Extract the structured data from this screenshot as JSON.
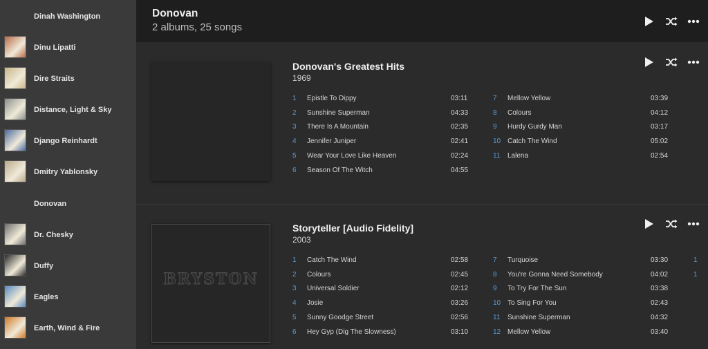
{
  "sidebar": {
    "artists": [
      {
        "name": "Dinah Washington",
        "has_thumb": false,
        "thumb_color": "#3a3a3a"
      },
      {
        "name": "Dinu Lipatti",
        "has_thumb": true,
        "thumb_color": "#b86a4a"
      },
      {
        "name": "Dire Straits",
        "has_thumb": true,
        "thumb_color": "#c9b58a"
      },
      {
        "name": "Distance, Light & Sky",
        "has_thumb": true,
        "thumb_color": "#8a8f8c"
      },
      {
        "name": "Django Reinhardt",
        "has_thumb": true,
        "thumb_color": "#4a6aa0"
      },
      {
        "name": "Dmitry Yablonsky",
        "has_thumb": true,
        "thumb_color": "#b8a98a"
      },
      {
        "name": "Donovan",
        "has_thumb": false,
        "thumb_color": "#3a3a3a"
      },
      {
        "name": "Dr. Chesky",
        "has_thumb": true,
        "thumb_color": "#6e6e6e"
      },
      {
        "name": "Duffy",
        "has_thumb": true,
        "thumb_color": "#2a2a2a"
      },
      {
        "name": "Eagles",
        "has_thumb": true,
        "thumb_color": "#5a8ac0"
      },
      {
        "name": "Earth, Wind & Fire",
        "has_thumb": true,
        "thumb_color": "#d07a2a"
      }
    ]
  },
  "header": {
    "title": "Donovan",
    "subtitle": "2 albums, 25 songs"
  },
  "albums": [
    {
      "title": "Donovan's Greatest Hits",
      "year": "1969",
      "cover_text": "",
      "tracks_left": [
        {
          "num": "1",
          "title": "Epistle To Dippy",
          "duration": "03:11"
        },
        {
          "num": "2",
          "title": "Sunshine Superman",
          "duration": "04:33"
        },
        {
          "num": "3",
          "title": "There Is A Mountain",
          "duration": "02:35"
        },
        {
          "num": "4",
          "title": "Jennifer Juniper",
          "duration": "02:41"
        },
        {
          "num": "5",
          "title": "Wear Your Love Like Heaven",
          "duration": "02:24"
        },
        {
          "num": "6",
          "title": "Season Of The Witch",
          "duration": "04:55"
        }
      ],
      "tracks_right": [
        {
          "num": "7",
          "title": "Mellow Yellow",
          "duration": "03:39"
        },
        {
          "num": "8",
          "title": "Colours",
          "duration": "04:12"
        },
        {
          "num": "9",
          "title": "Hurdy Gurdy Man",
          "duration": "03:17"
        },
        {
          "num": "10",
          "title": "Catch The Wind",
          "duration": "05:02"
        },
        {
          "num": "11",
          "title": "Lalena",
          "duration": "02:54"
        }
      ]
    },
    {
      "title": "Storyteller [Audio Fidelity]",
      "year": "2003",
      "cover_text": "BRYSTON",
      "tracks_left": [
        {
          "num": "1",
          "title": "Catch The Wind",
          "duration": "02:58"
        },
        {
          "num": "2",
          "title": "Colours",
          "duration": "02:45"
        },
        {
          "num": "3",
          "title": "Universal Soldier",
          "duration": "02:12"
        },
        {
          "num": "4",
          "title": "Josie",
          "duration": "03:26"
        },
        {
          "num": "5",
          "title": "Sunny Goodge Street",
          "duration": "02:56"
        },
        {
          "num": "6",
          "title": "Hey Gyp (Dig The Slowness)",
          "duration": "03:10"
        }
      ],
      "tracks_right": [
        {
          "num": "7",
          "title": "Turquoise",
          "duration": "03:30"
        },
        {
          "num": "8",
          "title": "You're Gonna Need Somebody",
          "duration": "04:02"
        },
        {
          "num": "9",
          "title": "To Try For The Sun",
          "duration": "03:38"
        },
        {
          "num": "10",
          "title": "To Sing For You",
          "duration": "02:43"
        },
        {
          "num": "11",
          "title": "Sunshine Superman",
          "duration": "04:32"
        },
        {
          "num": "12",
          "title": "Mellow Yellow",
          "duration": "03:40"
        }
      ],
      "tracks_third_col": [
        "1",
        "1"
      ]
    }
  ],
  "icons": {
    "play": "play-icon",
    "shuffle": "shuffle-icon",
    "more": "more-icon"
  },
  "colors": {
    "track_number": "#5b9bd5",
    "header_bg": "#1e1e1e",
    "sidebar_bg": "#3a3a3a",
    "content_bg": "#2b2b2b"
  }
}
